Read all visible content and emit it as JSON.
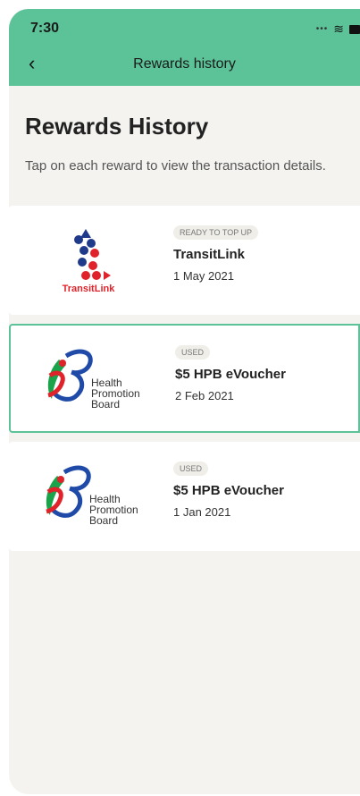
{
  "status": {
    "time": "7:30",
    "signal_dots": "•••",
    "wifi_glyph": "≋"
  },
  "nav": {
    "back_glyph": "‹",
    "title": "Rewards history"
  },
  "page": {
    "heading": "Rewards History",
    "subtitle": "Tap on each reward to view the transaction details."
  },
  "rewards": [
    {
      "badge": "READY TO TOP UP",
      "title": "TransitLink",
      "date": "1 May 2021",
      "logo_text": "TransitLink"
    },
    {
      "badge": "USED",
      "title": "$5 HPB eVoucher",
      "date": "2 Feb 2021",
      "logo_lines": [
        "Health",
        "Promotion",
        "Board"
      ]
    },
    {
      "badge": "USED",
      "title": "$5 HPB eVoucher",
      "date": "1 Jan 2021",
      "logo_lines": [
        "Health",
        "Promotion",
        "Board"
      ]
    }
  ],
  "colors": {
    "accent": "#5cc398",
    "background": "#f4f3f0"
  }
}
